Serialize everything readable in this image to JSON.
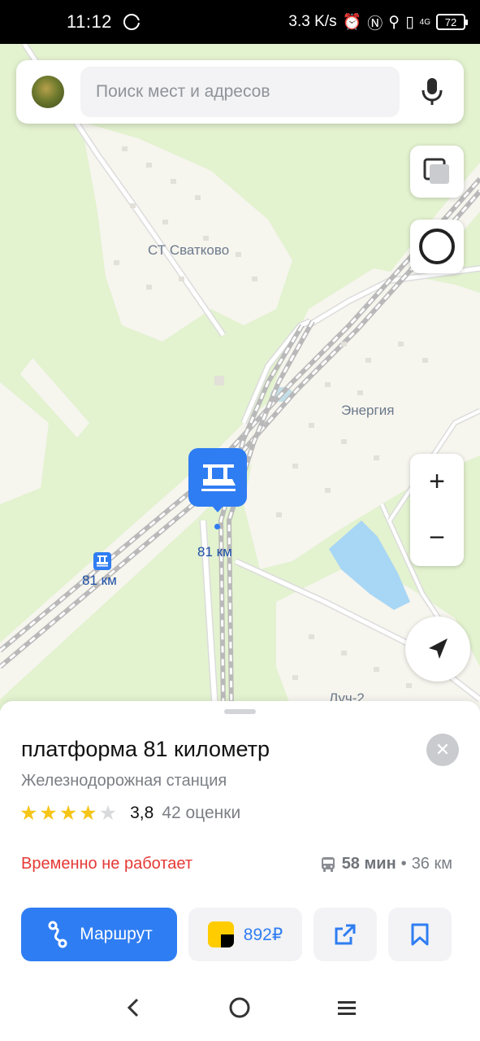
{
  "status_bar": {
    "time": "11:12",
    "speed": "3.3 K/s",
    "network": "4G",
    "battery": "72"
  },
  "search": {
    "placeholder": "Поиск мест и адресов"
  },
  "map": {
    "labels": {
      "st_svatkovo": "СТ Сватково",
      "energia": "Энергия",
      "luch2": "Луч-2"
    },
    "stations": {
      "main_pin_label": "81 км",
      "secondary_label": "81 км"
    },
    "zoom_in": "+",
    "zoom_out": "−"
  },
  "place": {
    "title": "платформа 81 километр",
    "category": "Железнодорожная станция",
    "rating": "3,8",
    "rating_stars": 4,
    "rating_count": "42 оценки",
    "status": "Временно не работает",
    "transit_time": "58 мин",
    "separator": "•",
    "distance": "36 км"
  },
  "actions": {
    "route_label": "Маршрут",
    "taxi_price": "892₽"
  },
  "colors": {
    "accent": "#2f7df2",
    "status_red": "#e53935",
    "map_green": "#e3f2cf",
    "star": "#f5c518"
  }
}
